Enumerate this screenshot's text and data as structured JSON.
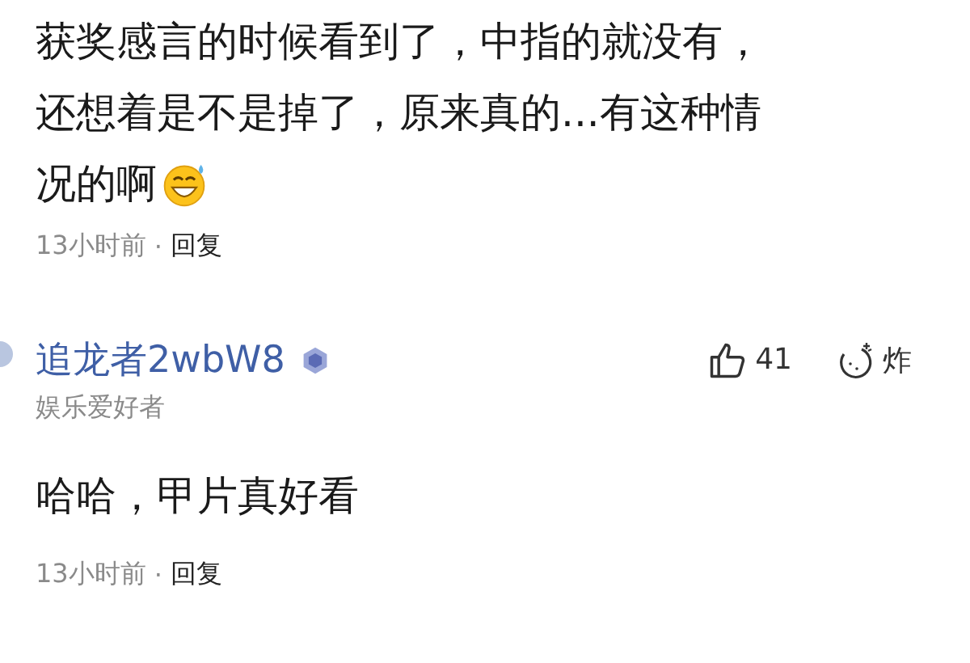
{
  "comment": {
    "lines": [
      "获奖感言的时候看到了，中指的就没有，",
      "还想着是不是掉了，原来真的...有这种情",
      "况的啊"
    ],
    "time": "13小时前",
    "separator": "·",
    "reply": "回复"
  },
  "reply_comment": {
    "username": "追龙者2wbW8",
    "tagline": "娱乐爱好者",
    "likes": "41",
    "bomb_label": "炸",
    "text": "哈哈，甲片真好看",
    "time": "13小时前",
    "separator": "·",
    "reply": "回复"
  }
}
